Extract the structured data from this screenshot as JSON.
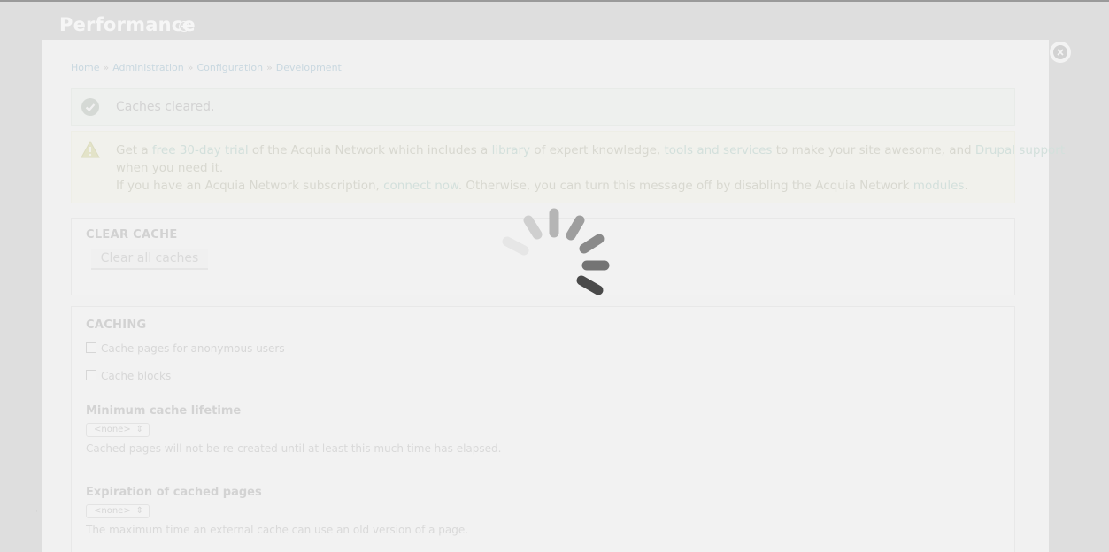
{
  "page": {
    "title": "Performance",
    "breadcrumb": [
      "Home",
      "Administration",
      "Configuration",
      "Development"
    ],
    "breadcrumb_separator": "»"
  },
  "messages": {
    "status": "Caches cleared.",
    "warning": {
      "line1_prefix": "Get a ",
      "line1_link1": "free 30-day trial",
      "line1_mid1": " of the Acquia Network which includes a ",
      "line1_link2": "library",
      "line1_mid2": " of expert knowledge, ",
      "line1_link3": "tools and services",
      "line1_mid3": " to make your site awesome, and ",
      "line1_link4": "Drupal support",
      "line2": "when you need it.",
      "line3_prefix": "If you have an Acquia Network subscription, ",
      "line3_link1": "connect now",
      "line3_mid": ". Otherwise, you can turn this message off by disabling the Acquia Network ",
      "line3_link2": "modules",
      "line3_suffix": "."
    }
  },
  "clear_cache": {
    "legend": "CLEAR CACHE",
    "button": "Clear all caches"
  },
  "caching": {
    "legend": "CACHING",
    "checkbox_anonymous": "Cache pages for anonymous users",
    "checkbox_blocks": "Cache blocks",
    "min_lifetime_label": "Minimum cache lifetime",
    "min_lifetime_value": "<none>",
    "min_lifetime_desc": "Cached pages will not be re-created until at least this much time has elapsed.",
    "expiration_label": "Expiration of cached pages",
    "expiration_value": "<none>",
    "expiration_desc": "The maximum time an external cache can use an old version of a page."
  },
  "colors": {
    "overlay_bg": "#f1f1f1",
    "backdrop": "#dedede",
    "spinner_dark": "#3f3f3f"
  },
  "icons": [
    "plus-icon",
    "close-icon",
    "check-icon",
    "warning-icon",
    "loading-spinner-icon"
  ]
}
